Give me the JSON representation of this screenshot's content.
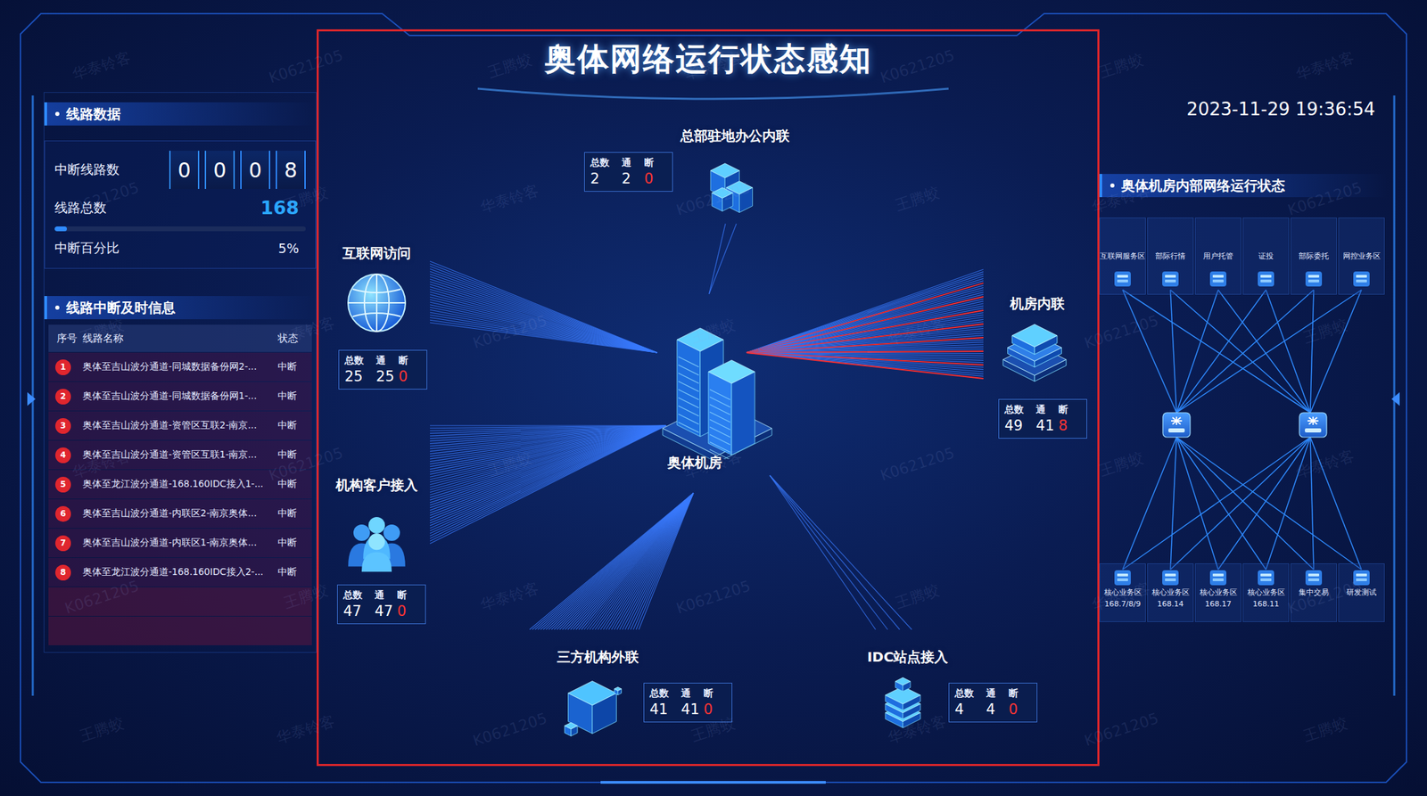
{
  "title": "奥体网络运行状态感知",
  "datetime": "2023-11-29 19:36:54",
  "watermarks": [
    "华泰铃客",
    "K0621205",
    "王腾蛟"
  ],
  "line_data": {
    "title": "线路数据",
    "interrupted_label": "中断线路数",
    "interrupted_digits": [
      "0",
      "0",
      "0",
      "8"
    ],
    "total_label": "线路总数",
    "total": "168",
    "ratio_label": "中断百分比",
    "ratio": "5%",
    "level": 0.05
  },
  "interrupt_info": {
    "title": "线路中断及时信息",
    "columns": [
      "序号",
      "线路名称",
      "状态"
    ],
    "rows": [
      {
        "index": "1",
        "name": "奥体至吉山波分通道-同城数据备份网2-...",
        "status": "中断"
      },
      {
        "index": "2",
        "name": "奥体至吉山波分通道-同城数据备份网1-...",
        "status": "中断"
      },
      {
        "index": "3",
        "name": "奥体至吉山波分通道-资管区互联2-南京...",
        "status": "中断"
      },
      {
        "index": "4",
        "name": "奥体至吉山波分通道-资管区互联1-南京...",
        "status": "中断"
      },
      {
        "index": "5",
        "name": "奥体至龙江波分通道-168.160IDC接入1-...",
        "status": "中断"
      },
      {
        "index": "6",
        "name": "奥体至吉山波分通道-内联区2-南京奥体...",
        "status": "中断"
      },
      {
        "index": "7",
        "name": "奥体至吉山波分通道-内联区1-南京奥体...",
        "status": "中断"
      },
      {
        "index": "8",
        "name": "奥体至龙江波分通道-168.160IDC接入2-...",
        "status": "中断"
      }
    ]
  },
  "stat_headers": [
    "总数",
    "通",
    "断"
  ],
  "center": {
    "label": "奥体机房"
  },
  "nodes": [
    {
      "label": "总部驻地办公内联",
      "kind": "offices",
      "total": "2",
      "up": "2",
      "down": "0"
    },
    {
      "label": "互联网访问",
      "kind": "globe",
      "total": "25",
      "up": "25",
      "down": "0"
    },
    {
      "label": "机房内联",
      "kind": "layers",
      "total": "49",
      "up": "41",
      "down": "8"
    },
    {
      "label": "机构客户接入",
      "kind": "people",
      "total": "47",
      "up": "47",
      "down": "0"
    },
    {
      "label": "三方机构外联",
      "kind": "cube",
      "total": "41",
      "up": "41",
      "down": "0"
    },
    {
      "label": "IDC站点接入",
      "kind": "server",
      "total": "4",
      "up": "4",
      "down": "0"
    }
  ],
  "internal_network": {
    "title": "奥体机房内部网络运行状态",
    "top_zones": [
      {
        "label": "互联网服务区"
      },
      {
        "label": "部际行情"
      },
      {
        "label": "用户托管"
      },
      {
        "label": "证投"
      },
      {
        "label": "部际委托"
      },
      {
        "label": "网控业务区"
      }
    ],
    "bottom_zones": [
      {
        "label": "核心业务区",
        "sub": "168.7/8/9"
      },
      {
        "label": "核心业务区",
        "sub": "168.14"
      },
      {
        "label": "核心业务区",
        "sub": "168.17"
      },
      {
        "label": "核心业务区",
        "sub": "168.11"
      },
      {
        "label": "集中交易"
      },
      {
        "label": "研发测试"
      }
    ]
  }
}
